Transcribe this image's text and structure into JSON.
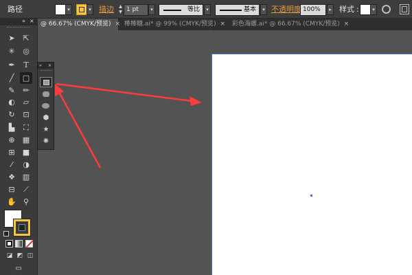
{
  "control_bar": {
    "object_type": "路径",
    "stroke_label": "描边",
    "stroke_weight": "1 pt",
    "profile_variable": "等比",
    "brush": "基本",
    "opacity_label": "不透明度",
    "opacity_value": "100%",
    "style_label": "样式",
    "colors": {
      "fill": "#ffffff",
      "stroke_swatch": "#f5c542",
      "accent_orange": "#e39a43"
    }
  },
  "tabs": [
    {
      "label": "@ 66.67% (CMYK/预览)",
      "active": true,
      "close": "×"
    },
    {
      "label": "棒棒糖.ai* @ 99% (CMYK/预览)",
      "active": false,
      "close": "×"
    },
    {
      "label": "彩色海螺.ai* @ 66.67% (CMYK/预览)",
      "active": false,
      "close": "×"
    }
  ],
  "tools_panel": {
    "header_collapse": "»",
    "header_close": "×",
    "icons": [
      "selection-tool-icon",
      "direct-selection-tool-icon",
      "magic-wand-tool-icon",
      "lasso-tool-icon",
      "pen-tool-icon",
      "type-tool-icon",
      "line-segment-tool-icon",
      "rectangle-tool-icon",
      "paintbrush-tool-icon",
      "pencil-tool-icon",
      "blob-brush-tool-icon",
      "eraser-tool-icon",
      "rotate-tool-icon",
      "scale-tool-icon",
      "width-tool-icon",
      "free-transform-tool-icon",
      "shape-builder-tool-icon",
      "perspective-grid-tool-icon",
      "mesh-tool-icon",
      "gradient-tool-icon",
      "eyedropper-tool-icon",
      "blend-tool-icon",
      "symbol-sprayer-tool-icon",
      "column-graph-tool-icon",
      "artboard-tool-icon",
      "slice-tool-icon",
      "hand-tool-icon",
      "zoom-tool-icon"
    ]
  },
  "flyout": {
    "header_collapse": "»",
    "header_close": "×",
    "items": [
      "rectangle-icon",
      "rounded-rectangle-icon",
      "ellipse-icon",
      "polygon-icon",
      "star-icon",
      "flare-icon"
    ]
  }
}
